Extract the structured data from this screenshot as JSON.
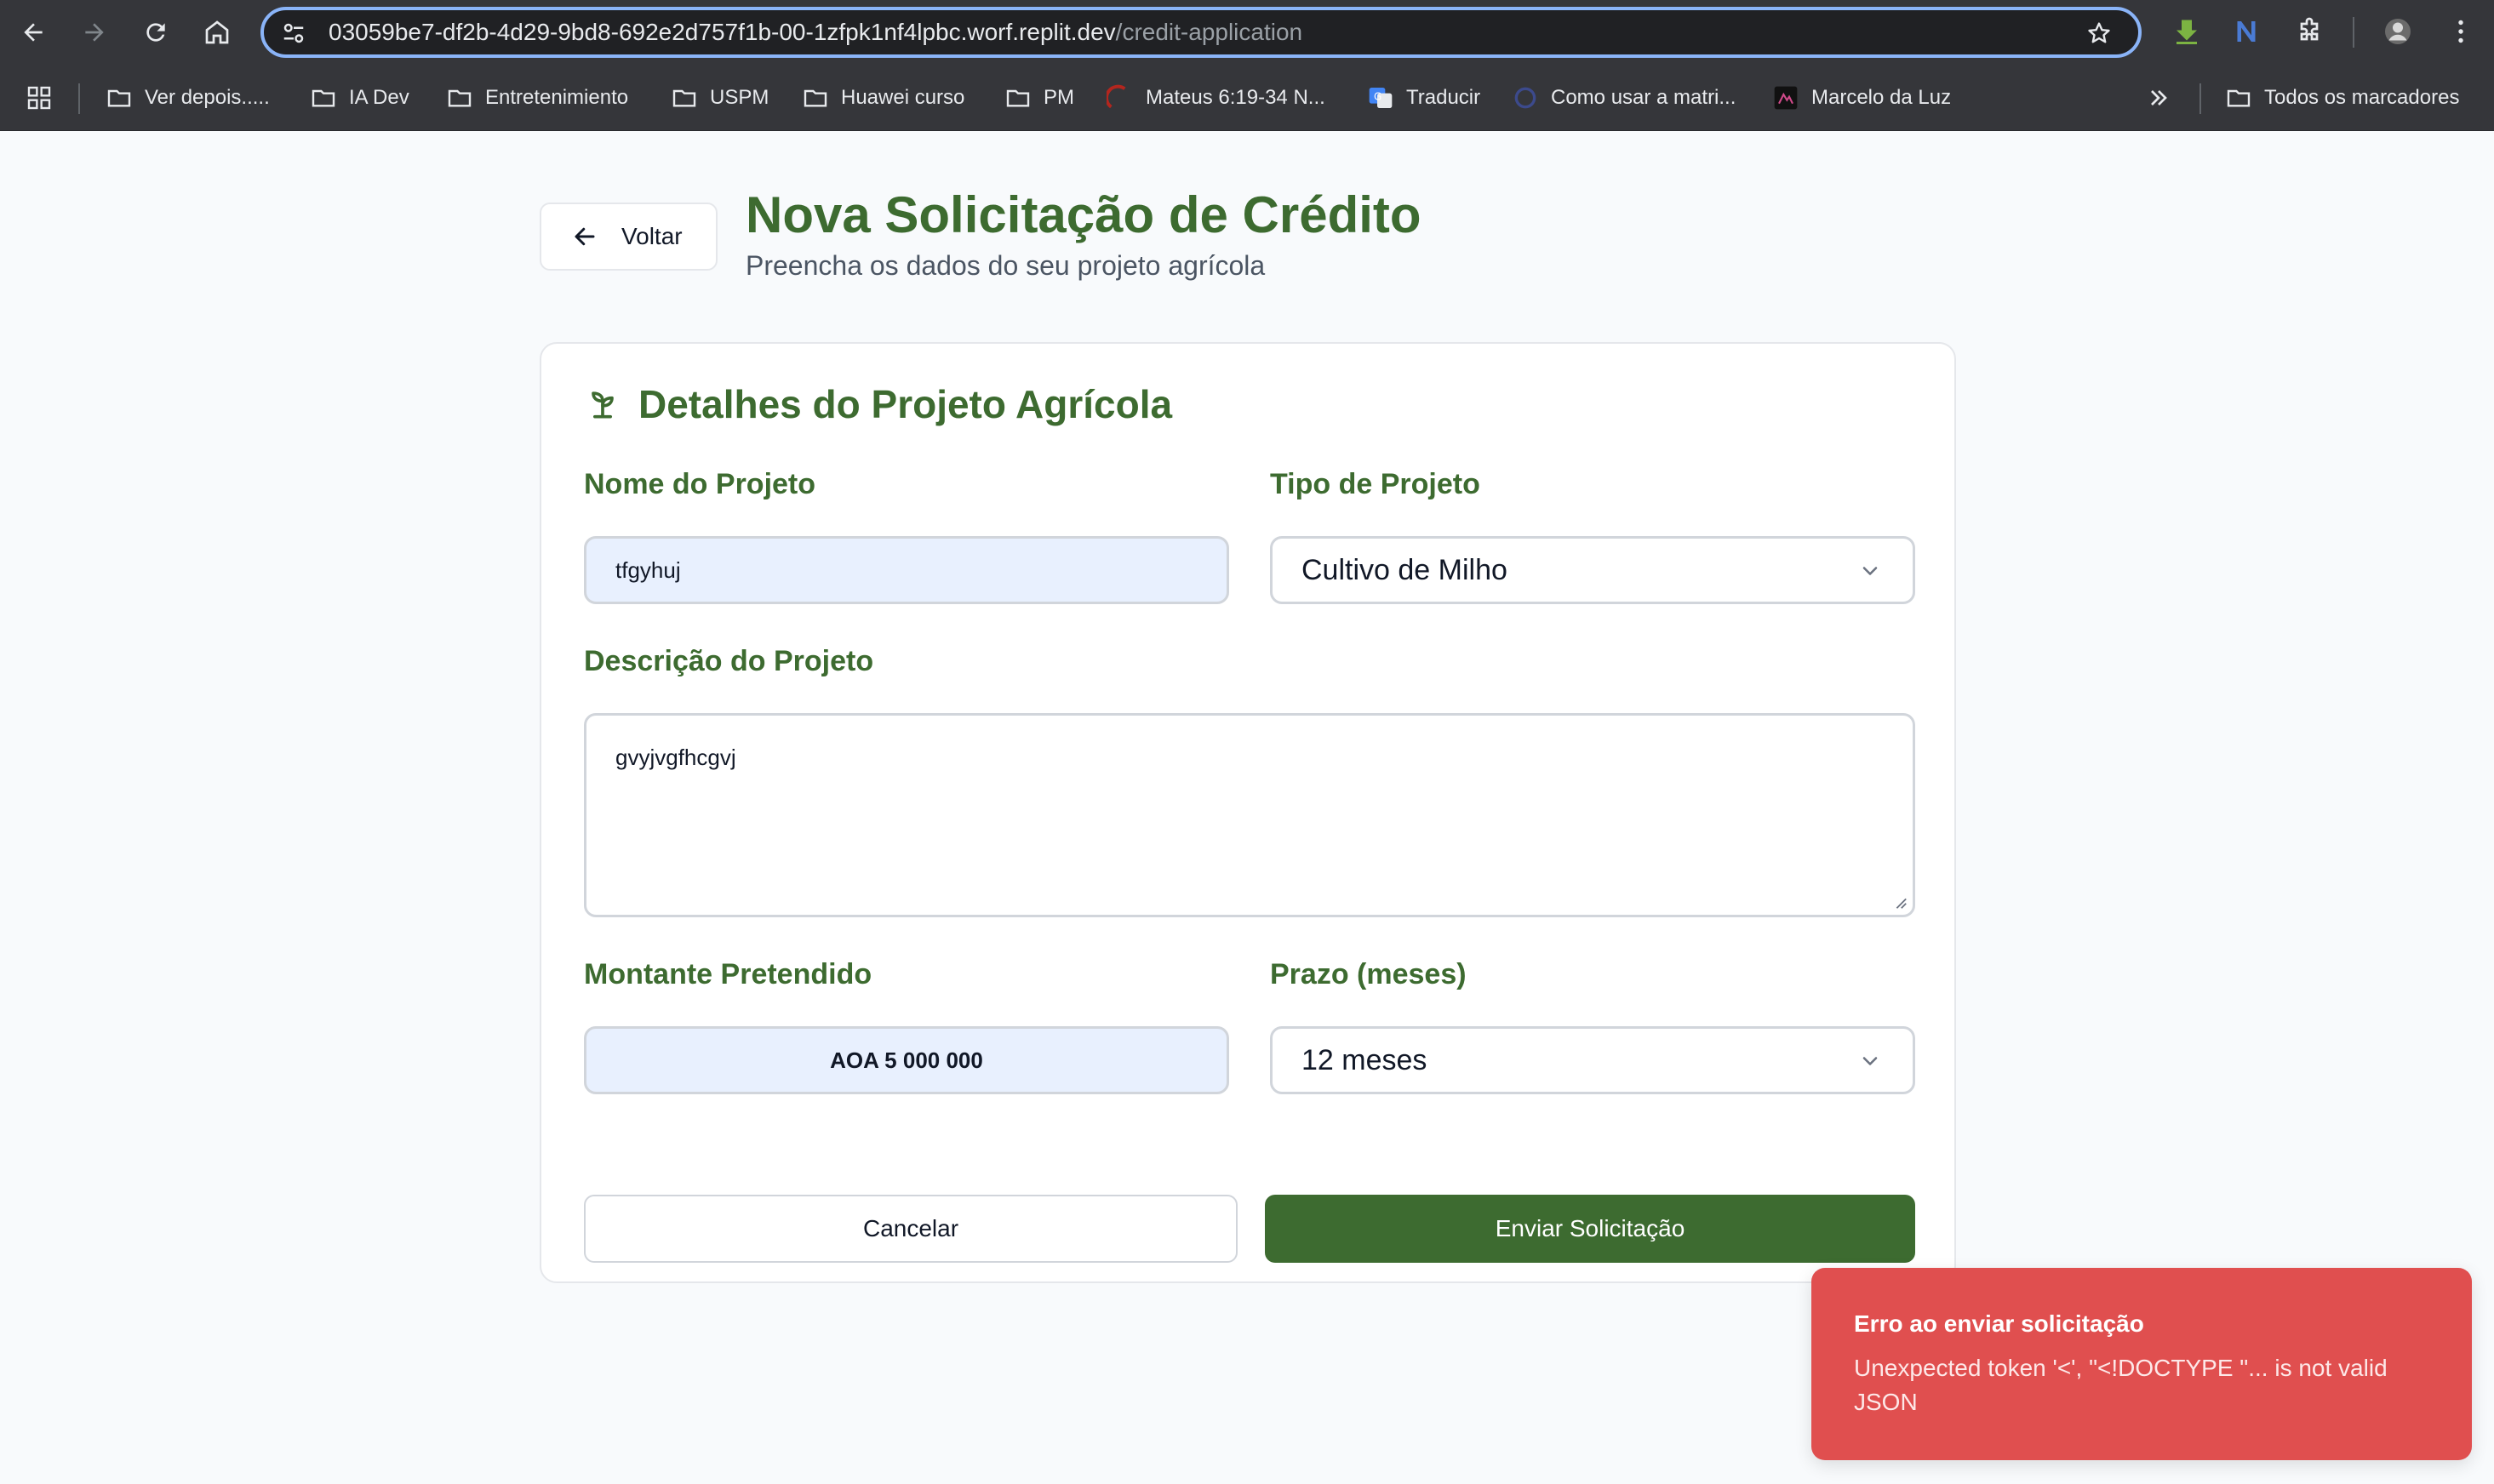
{
  "browser": {
    "url_host": "03059be7-df2b-4d29-9bd8-692e2d757f1b-00-1zfpk1nf4lpbc.worf.replit.dev",
    "url_path": "/credit-application",
    "bookmarks": [
      {
        "label": "Ver depois....."
      },
      {
        "label": "IA Dev"
      },
      {
        "label": "Entretenimiento"
      },
      {
        "label": "USPM"
      },
      {
        "label": "Huawei curso"
      },
      {
        "label": "PM"
      },
      {
        "label": "Mateus 6:19-34 N..."
      },
      {
        "label": "Traducir"
      },
      {
        "label": "Como usar a matri..."
      },
      {
        "label": "Marcelo da Luz"
      }
    ],
    "all_bookmarks_label": "Todos os marcadores"
  },
  "header": {
    "back_label": "Voltar",
    "title": "Nova Solicitação de Crédito",
    "subtitle": "Preencha os dados do seu projeto agrícola"
  },
  "form": {
    "section_title": "Detalhes do Projeto Agrícola",
    "project_name_label": "Nome do Projeto",
    "project_name_value": "tfgyhuj",
    "project_type_label": "Tipo de Projeto",
    "project_type_value": "Cultivo de Milho",
    "description_label": "Descrição do Projeto",
    "description_value": "gvyjvgfhcgvj",
    "amount_label": "Montante Pretendido",
    "amount_value": "AOA 5 000 000",
    "term_label": "Prazo (meses)",
    "term_value": "12 meses",
    "cancel_label": "Cancelar",
    "submit_label": "Enviar Solicitação"
  },
  "toast": {
    "title": "Erro ao enviar solicitação",
    "message": "Unexpected token '<', \"<!DOCTYPE \"... is not valid JSON"
  },
  "colors": {
    "brand_green": "#3d6b30",
    "error_red": "#e04f4f",
    "omnibox_focus": "#8ab4f8"
  }
}
